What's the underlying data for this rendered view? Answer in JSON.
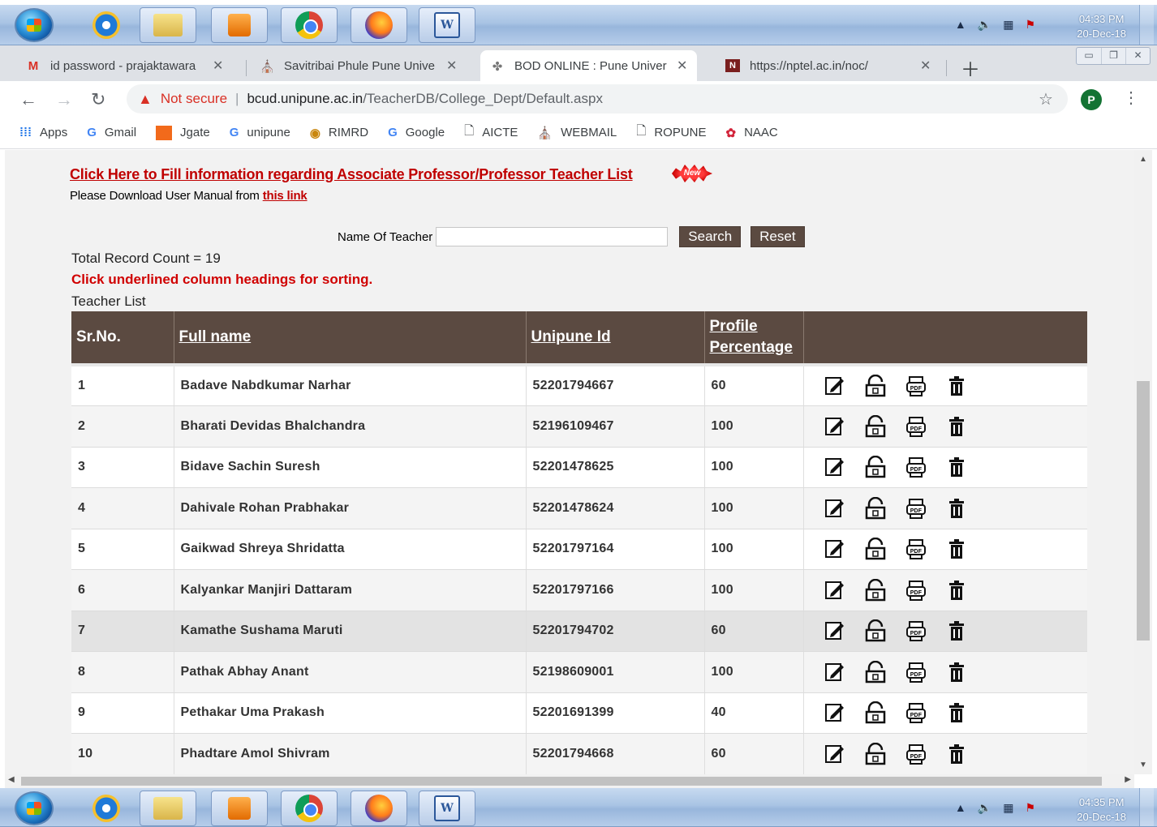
{
  "os": {
    "clock_top_time": "04:33 PM",
    "clock_top_date": "20-Dec-18",
    "clock_bottom_time": "04:35 PM",
    "clock_bottom_date": "20-Dec-18"
  },
  "browser": {
    "tabs": [
      {
        "label": "id password - prajaktawara",
        "icon": "gmail-icon"
      },
      {
        "label": "Savitribai Phule Pune Unive",
        "icon": "university-icon"
      },
      {
        "label": "BOD ONLINE : Pune Univer",
        "icon": "bod-icon"
      },
      {
        "label": "https://nptel.ac.in/noc/",
        "icon": "nptel-icon"
      }
    ],
    "address": {
      "not_secure": "Not secure",
      "host": "bcud.unipune.ac.in",
      "path": "/TeacherDB/College_Dept/Default.aspx"
    },
    "profile_initial": "P",
    "bookmarks": [
      {
        "label": "Apps",
        "icon": "apps-grid-icon"
      },
      {
        "label": "Gmail",
        "icon": "google-g-icon"
      },
      {
        "label": "Jgate",
        "icon": "jgate-icon"
      },
      {
        "label": "unipune",
        "icon": "google-g-icon"
      },
      {
        "label": "RIMRD",
        "icon": "rimrd-icon"
      },
      {
        "label": "Google",
        "icon": "google-g-icon"
      },
      {
        "label": "AICTE",
        "icon": "page-icon"
      },
      {
        "label": "WEBMAIL",
        "icon": "webmail-icon"
      },
      {
        "label": "ROPUNE",
        "icon": "page-icon"
      },
      {
        "label": "NAAC",
        "icon": "naac-icon"
      }
    ]
  },
  "page": {
    "fill_link": "Click Here to Fill information regarding Associate Professor/Professor Teacher List",
    "new_badge": "New",
    "manual_prefix": "Please Download User Manual from ",
    "manual_link": "this link",
    "search_label": "Name Of Teacher",
    "search_value": "",
    "search_button": "Search",
    "reset_button": "Reset",
    "total_count": "Total Record Count = 19",
    "sort_hint": "Click underlined column headings for sorting.",
    "list_title": "Teacher List",
    "columns": {
      "srno": "Sr.No.",
      "fullname": "Full name",
      "unipune": "Unipune Id",
      "profile_1": "Profile",
      "profile_2": "Percentage"
    },
    "rows": [
      {
        "sr": "1",
        "name": "Badave Nabdkumar Narhar",
        "id": "52201794667",
        "pct": "60"
      },
      {
        "sr": "2",
        "name": "Bharati Devidas Bhalchandra",
        "id": "52196109467",
        "pct": "100"
      },
      {
        "sr": "3",
        "name": "Bidave Sachin Suresh",
        "id": "52201478625",
        "pct": "100"
      },
      {
        "sr": "4",
        "name": "Dahivale Rohan Prabhakar",
        "id": "52201478624",
        "pct": "100"
      },
      {
        "sr": "5",
        "name": "Gaikwad Shreya Shridatta",
        "id": "52201797164",
        "pct": "100"
      },
      {
        "sr": "6",
        "name": "Kalyankar Manjiri Dattaram",
        "id": "52201797166",
        "pct": "100"
      },
      {
        "sr": "7",
        "name": "Kamathe Sushama Maruti",
        "id": "52201794702",
        "pct": "60"
      },
      {
        "sr": "8",
        "name": "Pathak Abhay Anant",
        "id": "52198609001",
        "pct": "100"
      },
      {
        "sr": "9",
        "name": "Pethakar Uma Prakash",
        "id": "52201691399",
        "pct": "40"
      },
      {
        "sr": "10",
        "name": "Phadtare Amol Shivram",
        "id": "52201794668",
        "pct": "60"
      }
    ],
    "row_actions": [
      "edit-icon",
      "unlock-icon",
      "pdf-icon",
      "delete-icon"
    ]
  }
}
